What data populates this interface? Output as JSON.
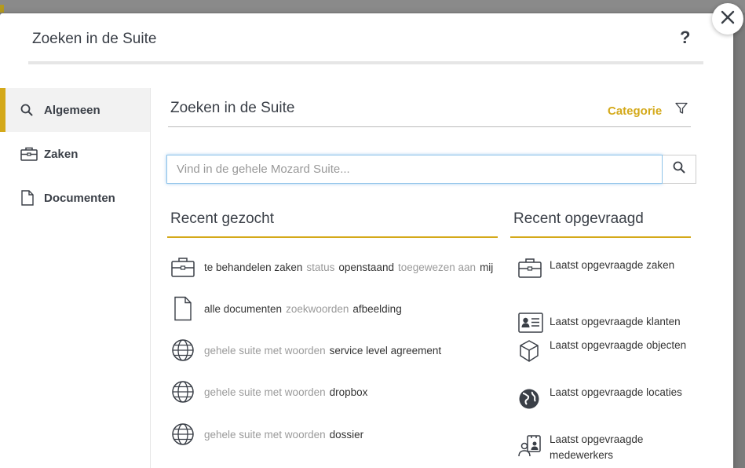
{
  "modal": {
    "title": "Zoeken in de Suite",
    "help": "?"
  },
  "sidebar": {
    "items": [
      {
        "label": "Algemeen",
        "icon": "search-icon",
        "active": true
      },
      {
        "label": "Zaken",
        "icon": "briefcase-icon",
        "active": false
      },
      {
        "label": "Documenten",
        "icon": "document-icon",
        "active": false
      }
    ]
  },
  "main": {
    "heading": "Zoeken in de Suite",
    "category_label": "Categorie",
    "search": {
      "placeholder": "Vind in de gehele Mozard Suite...",
      "value": ""
    }
  },
  "recent_searched": {
    "heading": "Recent gezocht",
    "items": [
      {
        "icon": "briefcase-icon",
        "parts": [
          {
            "text": "te behandelen zaken",
            "muted": false
          },
          {
            "text": "status",
            "muted": true
          },
          {
            "text": "openstaand",
            "muted": false
          },
          {
            "text": "toegewezen aan",
            "muted": true
          },
          {
            "text": "mij",
            "muted": false
          }
        ]
      },
      {
        "icon": "document-icon",
        "parts": [
          {
            "text": "alle documenten",
            "muted": false
          },
          {
            "text": "zoekwoorden",
            "muted": true
          },
          {
            "text": "afbeelding",
            "muted": false
          }
        ]
      },
      {
        "icon": "globe-icon",
        "parts": [
          {
            "text": "gehele suite met woorden",
            "muted": true
          },
          {
            "text": "service level agreement",
            "muted": false
          }
        ]
      },
      {
        "icon": "globe-icon",
        "parts": [
          {
            "text": "gehele suite met woorden",
            "muted": true
          },
          {
            "text": "dropbox",
            "muted": false
          }
        ]
      },
      {
        "icon": "globe-icon",
        "parts": [
          {
            "text": "gehele suite met woorden",
            "muted": true
          },
          {
            "text": "dossier",
            "muted": false
          }
        ]
      }
    ]
  },
  "recent_requested": {
    "heading": "Recent opgevraagd",
    "items": [
      {
        "icon": "briefcase-icon",
        "label": "Laatst opgevraagde zaken"
      },
      {
        "icon": "id-card-icon",
        "label": "Laatst opgevraagde klanten"
      },
      {
        "icon": "cube-icon",
        "label": "Laatst opgevraagde objecten"
      },
      {
        "icon": "earth-icon",
        "label": "Laatst opgevraagde locaties"
      },
      {
        "icon": "employees-icon",
        "label": "Laatst opgevraagde medewerkers"
      }
    ]
  },
  "colors": {
    "accent": "#d4a91a",
    "text": "#3a3f47",
    "muted": "#9a9a9a",
    "focus": "#8fc3e9"
  }
}
